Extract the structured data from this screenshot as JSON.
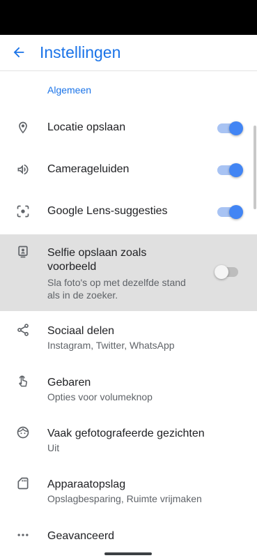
{
  "app": {
    "title": "Instellingen"
  },
  "section": {
    "header": "Algemeen"
  },
  "items": [
    {
      "icon": "location-pin-icon",
      "title": "Locatie opslaan",
      "toggle": "on"
    },
    {
      "icon": "volume-icon",
      "title": "Camerageluiden",
      "toggle": "on"
    },
    {
      "icon": "lens-icon",
      "title": "Google Lens-suggesties",
      "toggle": "on"
    },
    {
      "icon": "selfie-portrait-icon",
      "title_line1": "Selfie opslaan zoals",
      "title_line2": "voorbeeld",
      "subtitle_line1": "Sla foto's op met dezelfde stand",
      "subtitle_line2": "als in de zoeker.",
      "toggle": "off",
      "highlighted": true
    },
    {
      "icon": "share-icon",
      "title": "Sociaal delen",
      "subtitle": "Instagram, Twitter, WhatsApp"
    },
    {
      "icon": "gesture-hand-icon",
      "title": "Gebaren",
      "subtitle": "Opties voor volumeknop"
    },
    {
      "icon": "face-icon",
      "title": "Vaak gefotografeerde gezichten",
      "subtitle": "Uit"
    },
    {
      "icon": "sd-card-icon",
      "title": "Apparaatopslag",
      "subtitle": "Opslagbesparing, Ruimte vrijmaken"
    },
    {
      "icon": "more-horiz-icon",
      "title": "Geavanceerd"
    }
  ],
  "colors": {
    "accent": "#1a73e8",
    "toggle_on": "#4285f4",
    "highlight_bg": "#e0e0e0"
  }
}
